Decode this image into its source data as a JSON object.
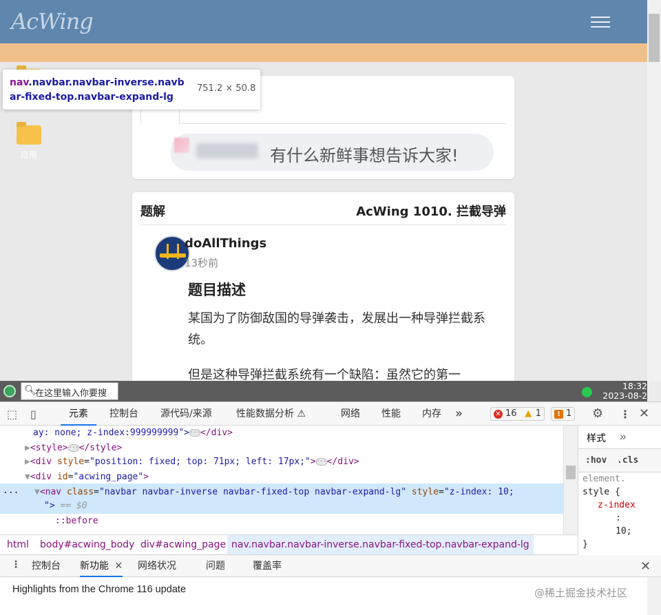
{
  "page": {
    "logo": "AcWing",
    "desktop_icon_label": "应用",
    "post_placeholder": "有什么新鲜事想告诉大家!",
    "card_label": "题解",
    "card_title": "AcWing 1010. 拦截导弹",
    "author": "doAllThings",
    "time": "13秒前",
    "section_title": "题目描述",
    "paragraph1": "某国为了防御敌国的导弹袭击，发展出一种导弹拦截系统。",
    "paragraph2": "但是这种导弹拦截系统有一个缺陷：虽然它的第一"
  },
  "tooltip": {
    "selector_tag": "nav",
    "selector_classes": ".navbar.navbar-inverse.navbar-fixed-top.navbar-expand-lg",
    "size": "751.2 × 50.8"
  },
  "taskbar": {
    "search_placeholder": "在这里输入你要搜",
    "time": "18:32",
    "date": "2023-08-2"
  },
  "devtools": {
    "tabs": [
      "元素",
      "控制台",
      "源代码/来源",
      "性能数据分析 ⚠",
      "网络",
      "性能",
      "内存"
    ],
    "more": "»",
    "errors": "16",
    "warnings": "1",
    "issues": "1",
    "lines": {
      "l1_text": "ay: none; z-index:999999999\">",
      "l1_close": "</div>",
      "l2_open": "<style>",
      "l2_close": "</style>",
      "l3_tag": "<div",
      "l3_attr": "style",
      "l3_val": "\"position: fixed; top: 71px; left: 17px;\"",
      "l3_end": ">",
      "l3_close": "</div>",
      "l4_tag": "<div",
      "l4_attr": "id",
      "l4_val": "\"acwing_page\"",
      "l4_end": ">",
      "l5_tag": "<nav",
      "l5_attr1": "class",
      "l5_val1": "\"navbar navbar-inverse navbar-fixed-top navbar-expand-lg\"",
      "l5_attr2": "style",
      "l5_val2": "\"z-index: 10;",
      "l6_val": "\">",
      "l6_eq": "== $0",
      "l7_text": "::before",
      "gutter_dots": "..."
    },
    "breadcrumb": [
      "html",
      "body#acwing_body",
      "div#acwing_page",
      "nav.navbar.navbar-inverse.navbar-fixed-top.navbar-expand-lg"
    ],
    "styles": {
      "tab": "样式",
      "hov": ":hov",
      "cls": ".cls",
      "selector1": "element.",
      "selector2": "style {",
      "prop": "z-index",
      "colon": ":",
      "value": "10;",
      "close": "}"
    },
    "drawer_tabs": [
      "控制台",
      "新功能",
      "网络状况",
      "问题",
      "覆盖率"
    ],
    "highlight_message": "Highlights from the Chrome 116 update",
    "watermark": "@稀土掘金技术社区"
  },
  "colors": {
    "navbar": "#5f86ad",
    "orange_strip": "#f0c08b",
    "tag": "#881280",
    "attr": "#994500",
    "value": "#1a1aa6",
    "selection": "#cfe8fc",
    "accent": "#1a73e8"
  }
}
